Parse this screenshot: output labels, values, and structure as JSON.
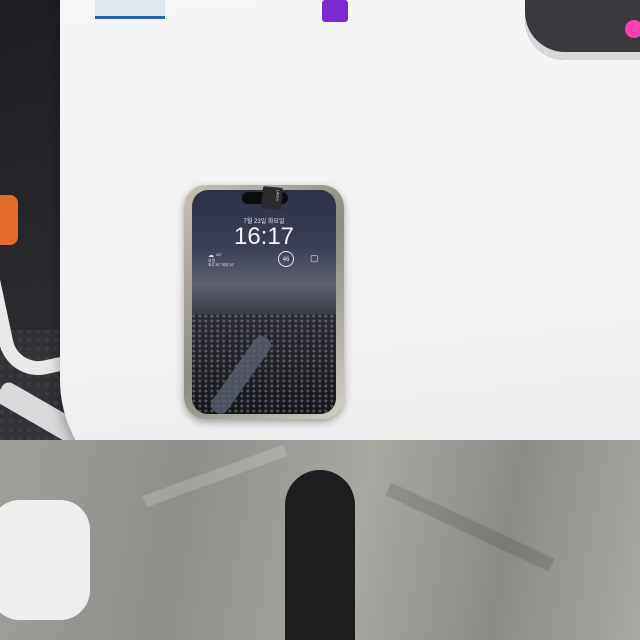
{
  "lockscreen": {
    "date": "7월 23일 화요일",
    "time": "16:17",
    "weather_icon": "cloud-icon",
    "weather_temp": "26°",
    "weather_condition": "흐림",
    "weather_detail": "최고 30° 최저 24°",
    "ring_value": "46",
    "widget_icon": "battery-icon"
  },
  "sticker_text": "LAWS"
}
